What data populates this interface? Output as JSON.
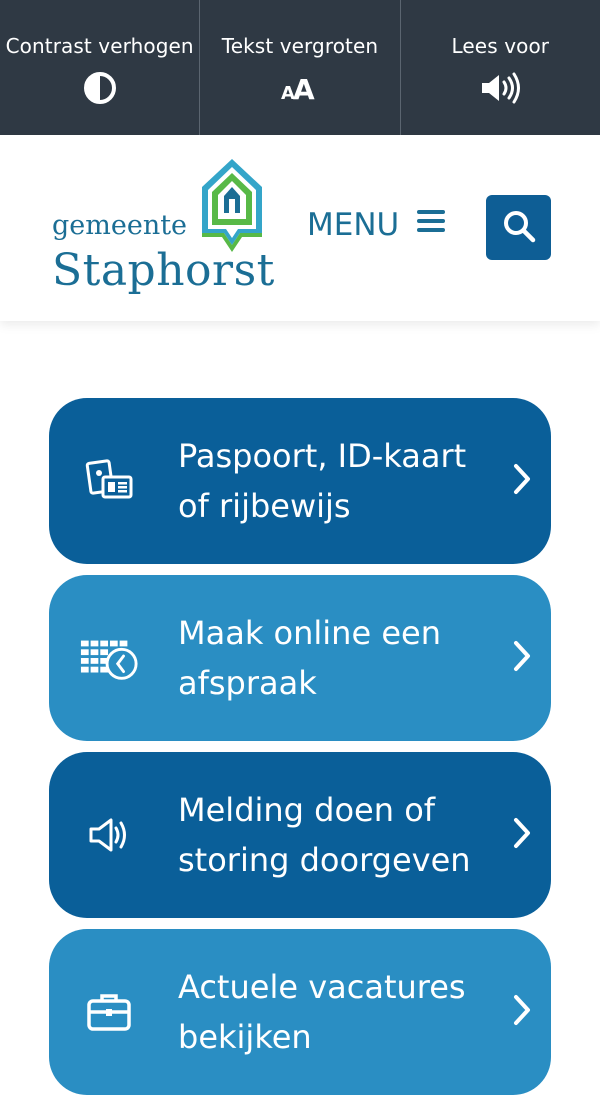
{
  "toolbar": {
    "items": [
      {
        "label": "Contrast verhogen",
        "icon": "contrast-icon"
      },
      {
        "label": "Tekst vergroten",
        "icon": "text-size-icon",
        "glyph": "aA"
      },
      {
        "label": "Lees voor",
        "icon": "speaker-icon"
      }
    ]
  },
  "header": {
    "logo_line1": "gemeente",
    "logo_line2": "Staphorst",
    "menu_label": "MENU",
    "search_icon": "search-icon"
  },
  "cards": [
    {
      "label": "Paspoort, ID-kaart of rijbewijs",
      "icon": "id-card-icon",
      "color": "#0a5f99"
    },
    {
      "label": "Maak online een afspraak",
      "icon": "calendar-clock-icon",
      "color": "#2a8ec3"
    },
    {
      "label": "Melding doen of storing doorgeven",
      "icon": "megaphone-icon",
      "color": "#0a5f99"
    },
    {
      "label": "Actuele vacatures bekijken",
      "icon": "briefcase-icon",
      "color": "#2a8ec3"
    }
  ],
  "colors": {
    "topbar": "#2f3944",
    "brand": "#1b6e95",
    "dark_card": "#0a5f99",
    "light_card": "#2a8ec3",
    "search_button": "#0e5e95"
  }
}
